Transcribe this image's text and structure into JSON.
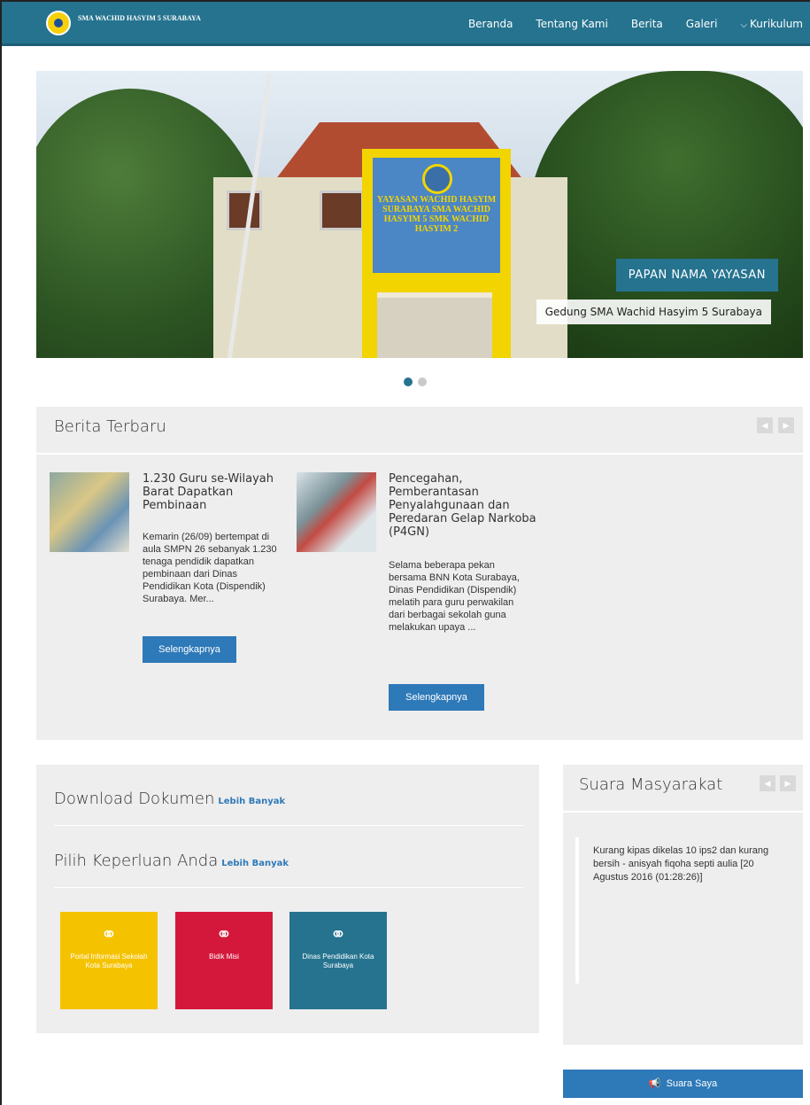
{
  "brand": {
    "name": "SMA WACHID HASYIM 5 SURABAYA"
  },
  "nav": {
    "items": [
      "Beranda",
      "Tentang Kami",
      "Berita",
      "Galeri",
      "Kurikulum"
    ]
  },
  "hero": {
    "sign_text": "YAYASAN WACHID HASYIM SURABAYA SMA WACHID HASYIM 5 SMK WACHID HASYIM 2",
    "caption_title": "PAPAN NAMA YAYASAN",
    "caption_subtitle": "Gedung SMA Wachid Hasyim 5 Surabaya"
  },
  "news": {
    "title": "Berita Terbaru",
    "items": [
      {
        "title": "1.230 Guru se-Wilayah Barat Dapatkan Pembinaan",
        "excerpt": "Kemarin (26/09) bertempat di aula SMPN 26 sebanyak 1.230 tenaga pendidik dapatkan pembinaan dari Dinas Pendidikan Kota (Dispendik) Surabaya. Mer...",
        "button": "Selengkapnya"
      },
      {
        "title": "Pencegahan, Pemberantasan Penyalahgunaan dan Peredaran Gelap Narkoba (P4GN)",
        "excerpt": "Selama beberapa pekan bersama BNN Kota Surabaya, Dinas Pendidikan (Dispendik) melatih para guru perwakilan dari berbagai sekolah guna melakukan upaya ...",
        "button": "Selengkapnya"
      }
    ]
  },
  "downloads": {
    "title": "Download Dokumen",
    "more": "Lebih Banyak",
    "needs_title": "Pilih Keperluan Anda",
    "needs_more": "Lebih Banyak",
    "tiles": [
      {
        "label": "Portal Informasi Sekolah Kota Surabaya",
        "color": "#f5c200"
      },
      {
        "label": "Bidik Misi",
        "color": "#d4183b"
      },
      {
        "label": "Dinas Pendidikan Kota Surabaya",
        "color": "#25738f"
      }
    ]
  },
  "suara": {
    "title": "Suara Masyarakat",
    "quote": "Kurang kipas dikelas 10 ips2 dan kurang bersih - anisyah fiqoha septi aulia [20 Agustus 2016 (01:28:26)]",
    "button": "Suara Saya"
  }
}
